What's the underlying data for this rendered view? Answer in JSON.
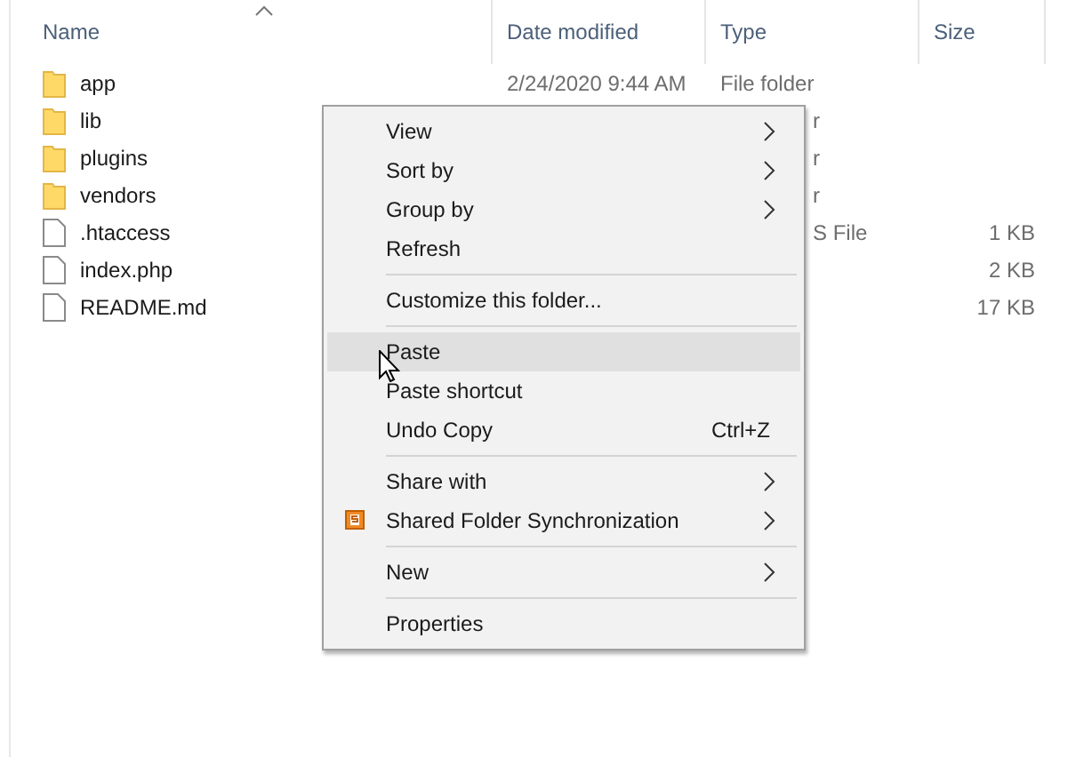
{
  "columns": [
    {
      "label": "Name"
    },
    {
      "label": "Date modified"
    },
    {
      "label": "Type"
    },
    {
      "label": "Size"
    }
  ],
  "files": [
    {
      "kind": "folder",
      "name": "app",
      "date": "2/24/2020 9:44 AM",
      "type": "File folder"
    },
    {
      "kind": "folder",
      "name": "lib",
      "type_fragment": "r"
    },
    {
      "kind": "folder",
      "name": "plugins",
      "type_fragment": "r"
    },
    {
      "kind": "folder",
      "name": "vendors",
      "type_fragment": "r"
    },
    {
      "kind": "file",
      "name": ".htaccess",
      "type_fragment": "S File",
      "size": "1 KB"
    },
    {
      "kind": "file",
      "name": "index.php",
      "size": "2 KB"
    },
    {
      "kind": "file",
      "name": "README.md",
      "size": "17 KB"
    }
  ],
  "menu": [
    [
      {
        "label": "View",
        "submenu": true,
        "selected": false
      },
      {
        "label": "Sort by",
        "submenu": true,
        "selected": false
      },
      {
        "label": "Group by",
        "submenu": true,
        "selected": false
      },
      {
        "label": "Refresh",
        "submenu": false,
        "selected": false
      }
    ],
    [
      {
        "label": "Customize this folder...",
        "submenu": false,
        "selected": false
      }
    ],
    [
      {
        "label": "Paste",
        "submenu": false,
        "selected": true
      },
      {
        "label": "Paste shortcut",
        "submenu": false,
        "selected": false
      },
      {
        "label": "Undo Copy",
        "shortcut": "Ctrl+Z",
        "submenu": false,
        "selected": false
      }
    ],
    [
      {
        "label": "Share with",
        "submenu": true,
        "selected": false
      },
      {
        "label": "Shared Folder Synchronization",
        "submenu": true,
        "selected": false,
        "kind": "sync"
      }
    ],
    [
      {
        "label": "New",
        "submenu": true,
        "selected": false
      }
    ],
    [
      {
        "label": "Properties",
        "submenu": false,
        "selected": false
      }
    ]
  ]
}
